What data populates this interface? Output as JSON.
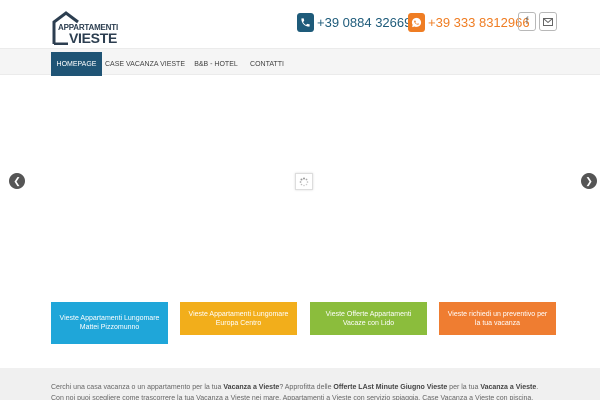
{
  "logo": {
    "line1": "APPARTAMENTI",
    "line2": "VIESTE"
  },
  "contacts": {
    "phone1": "+39 0884 326690",
    "phone2": "+39 333 8312966",
    "phone_icon": "phone-icon",
    "whatsapp_icon": "whatsapp-icon"
  },
  "social": {
    "facebook": "f",
    "mail_icon": "mail-icon"
  },
  "nav": {
    "items": [
      {
        "label": "HOMEPAGE",
        "active": true
      },
      {
        "label": "CASE VACANZA VIESTE",
        "active": false
      },
      {
        "label": "B&B - HOTEL",
        "active": false
      },
      {
        "label": "CONTATTI",
        "active": false
      }
    ]
  },
  "boxes": [
    {
      "label": "Vieste Appartamenti Lungomare Mattei Pizzomunno",
      "color": "#1fa6d9"
    },
    {
      "label": "Vieste Appartamenti Lungomare Europa Centro",
      "color": "#f2ae1b"
    },
    {
      "label": "Vieste Offerte Appartamenti Vacaze con Lido",
      "color": "#8bbd3c"
    },
    {
      "label": "Vieste richiedi un preventivo per la tua vacanza",
      "color": "#ef7d31"
    }
  ],
  "intro": {
    "t1": "Cerchi una casa vacanza o un appartamento per la tua ",
    "b1": "Vacanza a Vieste",
    "t2": "? Approfitta delle ",
    "b2": "Offerte LAst Minute Giugno Vieste",
    "t3": " per la tua ",
    "b3": "Vacanza a Vieste",
    "t4": ". Con noi puoi scegliere come trascorrere la tua Vacanza a Vieste nei mare. Appartamenti a Vieste con servizio spiaggia, Case Vacanza a Vieste con piscina, Case economiche a Vieste"
  },
  "colors": {
    "brand_blue": "#1f5475",
    "accent_orange": "#ef7d23"
  }
}
